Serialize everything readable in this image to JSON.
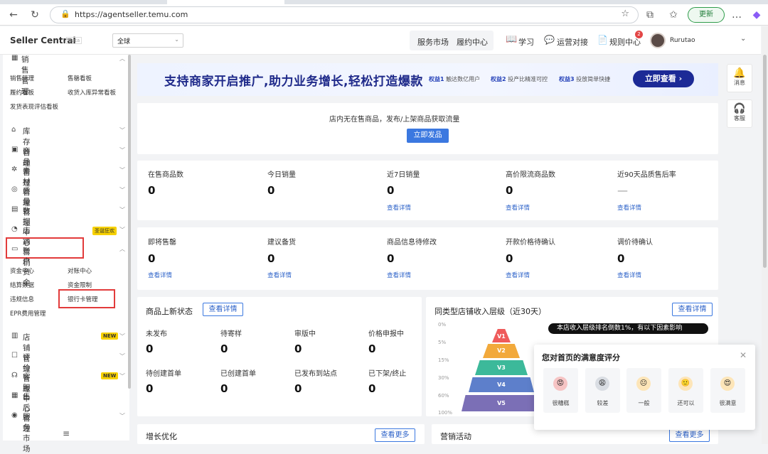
{
  "browser": {
    "url": "https://agentseller.temu.com",
    "update_label": "更新"
  },
  "header": {
    "brand": "Seller Central",
    "beta": "Beta",
    "region": "全球",
    "service_market": "服务市场",
    "fulfillment": "履约中心",
    "learn": "学习",
    "ops": "运营对接",
    "rules": "规则中心",
    "rules_badge": "2",
    "username": "Rurutao"
  },
  "sidebar": {
    "sales": {
      "title": "销售管理",
      "items": [
        "销售管理",
        "售罄看板",
        "履约看板",
        "收货入库异常看板",
        "发货表现评估看板"
      ]
    },
    "menus": [
      {
        "label": "库存管理",
        "icon": "stock-icon"
      },
      {
        "label": "商品管理",
        "icon": "product-icon"
      },
      {
        "label": "素材管理",
        "icon": "material-icon"
      },
      {
        "label": "质量管理",
        "icon": "quality-icon"
      },
      {
        "label": "数据中心",
        "icon": "data-icon"
      },
      {
        "label": "店铺营销",
        "icon": "marketing-icon"
      }
    ],
    "marketing_badge": "圣诞狂欢",
    "account": {
      "title": "账户资金",
      "items": [
        "资金中心",
        "对账中心",
        "结算数据",
        "资金限制",
        "违规信息",
        "银行卡管理",
        "EPR费用管理"
      ]
    },
    "bottom_menus": [
      {
        "label": "店铺管理"
      },
      {
        "label": "评价管理"
      },
      {
        "label": "客服中心"
      },
      {
        "label": "售后管理"
      },
      {
        "label": "服务市场"
      }
    ],
    "new_badge": "NEW"
  },
  "banner": {
    "headline": "支持商家开启推广,助力业务增长,轻松打造爆款",
    "perks": [
      {
        "tag": "权益1",
        "text": "触达数亿用户"
      },
      {
        "tag": "权益2",
        "text": "投产比精准可控"
      },
      {
        "tag": "权益3",
        "text": "投放简单快捷"
      }
    ],
    "cta": "立即查看"
  },
  "empty_store": {
    "message": "店内无在售商品，发布/上架商品获取流量",
    "button": "立即发品"
  },
  "stats_row1": [
    {
      "label": "在售商品数",
      "value": "0",
      "link": ""
    },
    {
      "label": "今日销量",
      "value": "0",
      "link": ""
    },
    {
      "label": "近7日销量",
      "value": "0",
      "link": "查看详情"
    },
    {
      "label": "高价限流商品数",
      "value": "0",
      "link": "查看详情"
    },
    {
      "label": "近90天品质售后率",
      "value": "—",
      "link": "查看详情"
    }
  ],
  "stats_row2": [
    {
      "label": "即将售罄",
      "value": "0",
      "link": "查看详情"
    },
    {
      "label": "建议备货",
      "value": "0",
      "link": "查看详情"
    },
    {
      "label": "商品信息待修改",
      "value": "0",
      "link": "查看详情"
    },
    {
      "label": "开款价格待确认",
      "value": "0",
      "link": "查看详情"
    },
    {
      "label": "调价待确认",
      "value": "0",
      "link": "查看详情"
    }
  ],
  "new_status": {
    "title": "商品上新状态",
    "detail": "查看详情",
    "items": [
      {
        "label": "未发布",
        "value": "0"
      },
      {
        "label": "待寄样",
        "value": "0"
      },
      {
        "label": "审版中",
        "value": "0"
      },
      {
        "label": "价格申报中",
        "value": "0"
      },
      {
        "label": "待创建首单",
        "value": "0"
      },
      {
        "label": "已创建首单",
        "value": "0"
      },
      {
        "label": "已发布到站点",
        "value": "0"
      },
      {
        "label": "已下架/终止",
        "value": "0"
      }
    ]
  },
  "income_level": {
    "title": "同类型店铺收入层级（近30天）",
    "detail": "查看详情",
    "tooltip": "本店收入层级排名倒数1%，有以下因素影响",
    "percent_labels": [
      "0%",
      "5%",
      "15%",
      "30%",
      "60%",
      "100%"
    ],
    "levels": [
      "V1",
      "V2",
      "V3",
      "V4",
      "V5"
    ],
    "level_colors": [
      "#ef5b5b",
      "#f2a93b",
      "#3cb99a",
      "#5d7fcb",
      "#7b6fb6"
    ]
  },
  "growth": {
    "title": "增长优化",
    "more": "查看更多"
  },
  "marketing": {
    "title": "营销活动",
    "more": "查看更多"
  },
  "survey": {
    "title": "您对首页的满意度评分",
    "options": [
      {
        "label": "很糟糕",
        "face": "😡",
        "color": "#f6c4c4"
      },
      {
        "label": "较差",
        "face": "😩",
        "color": "#d9dde3"
      },
      {
        "label": "一般",
        "face": "😐",
        "color": "#fde5b8"
      },
      {
        "label": "还可以",
        "face": "🙂",
        "color": "#fde5b8"
      },
      {
        "label": "很满意",
        "face": "😍",
        "color": "#fde5b8"
      }
    ]
  },
  "float": {
    "messages": "消息",
    "service": "客服"
  }
}
